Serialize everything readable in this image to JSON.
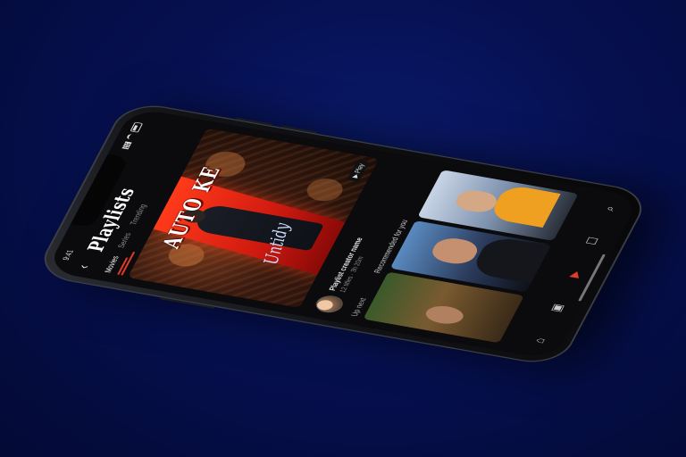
{
  "status": {
    "time": "9:41"
  },
  "header": {
    "back_icon": "back-arrow-icon",
    "title": "Playlists",
    "tabs": [
      "Movies",
      "Series",
      "Trending"
    ]
  },
  "hero": {
    "title": "AUTO KE",
    "subtitle": "Untidy",
    "badge": "▶ Play"
  },
  "info": {
    "title": "Playlist creator name",
    "meta": "12 titles · 3h 20m"
  },
  "sections": {
    "label_left": "Up next",
    "label_right": "Recommended for you"
  },
  "thumbs": [
    {
      "caption": ""
    },
    {
      "caption": ""
    },
    {
      "caption": ""
    }
  ],
  "nav": {
    "items": [
      "⌂",
      "▣",
      "▶",
      "☐",
      "⌕"
    ]
  },
  "colors": {
    "accent": "#e23a2b",
    "background": "#061050",
    "screen": "#0b0b0d"
  }
}
